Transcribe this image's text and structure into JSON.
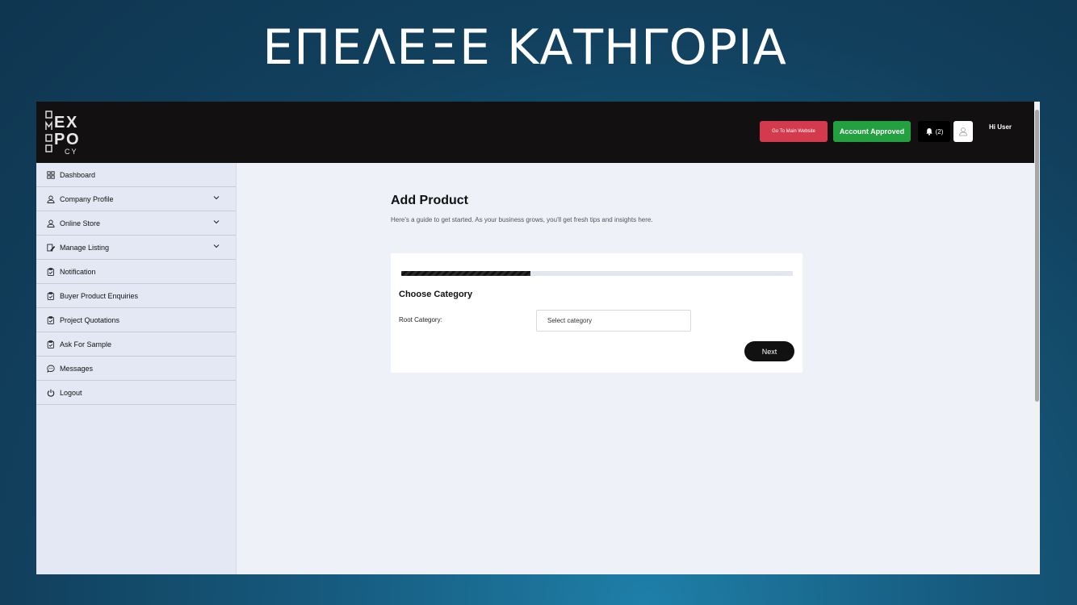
{
  "slide": {
    "title": "ΕΠΕΛΕΞΕ ΚΑΤΗΓΟΡΙΑ"
  },
  "logo": {
    "letters": [
      "E",
      "X",
      "P",
      "O"
    ],
    "side": "ΟΜΟΡ",
    "cy": "CY"
  },
  "header": {
    "go_main": "Go To Main Website",
    "approved": "Account Approved",
    "notifications_count": "(2)",
    "greeting": "Hi User"
  },
  "colors": {
    "main_button": "#d43a4d",
    "approved": "#23a140",
    "topbar": "#121011"
  },
  "sidebar": {
    "items": [
      {
        "label": "Dashboard",
        "icon": "grid-icon"
      },
      {
        "label": "Company Profile",
        "icon": "user-icon",
        "expandable": true
      },
      {
        "label": "Online Store",
        "icon": "user-icon",
        "expandable": true
      },
      {
        "label": "Manage Listing",
        "icon": "edit-icon",
        "expandable": true
      },
      {
        "label": "Notification",
        "icon": "clipboard-icon"
      },
      {
        "label": "Buyer Product Enquiries",
        "icon": "clipboard-icon"
      },
      {
        "label": "Project Quotations",
        "icon": "clipboard-icon"
      },
      {
        "label": "Ask For Sample",
        "icon": "clipboard-icon"
      },
      {
        "label": "Messages",
        "icon": "chat-icon"
      },
      {
        "label": "Logout",
        "icon": "power-icon"
      }
    ]
  },
  "main": {
    "title": "Add Product",
    "subtitle": "Here's a guide to get started. As your business grows, you'll get fresh tips and insights here.",
    "progress": 0.33,
    "section_title": "Choose Category",
    "root_label": "Root Category:",
    "select_placeholder": "Select category",
    "next": "Next"
  }
}
